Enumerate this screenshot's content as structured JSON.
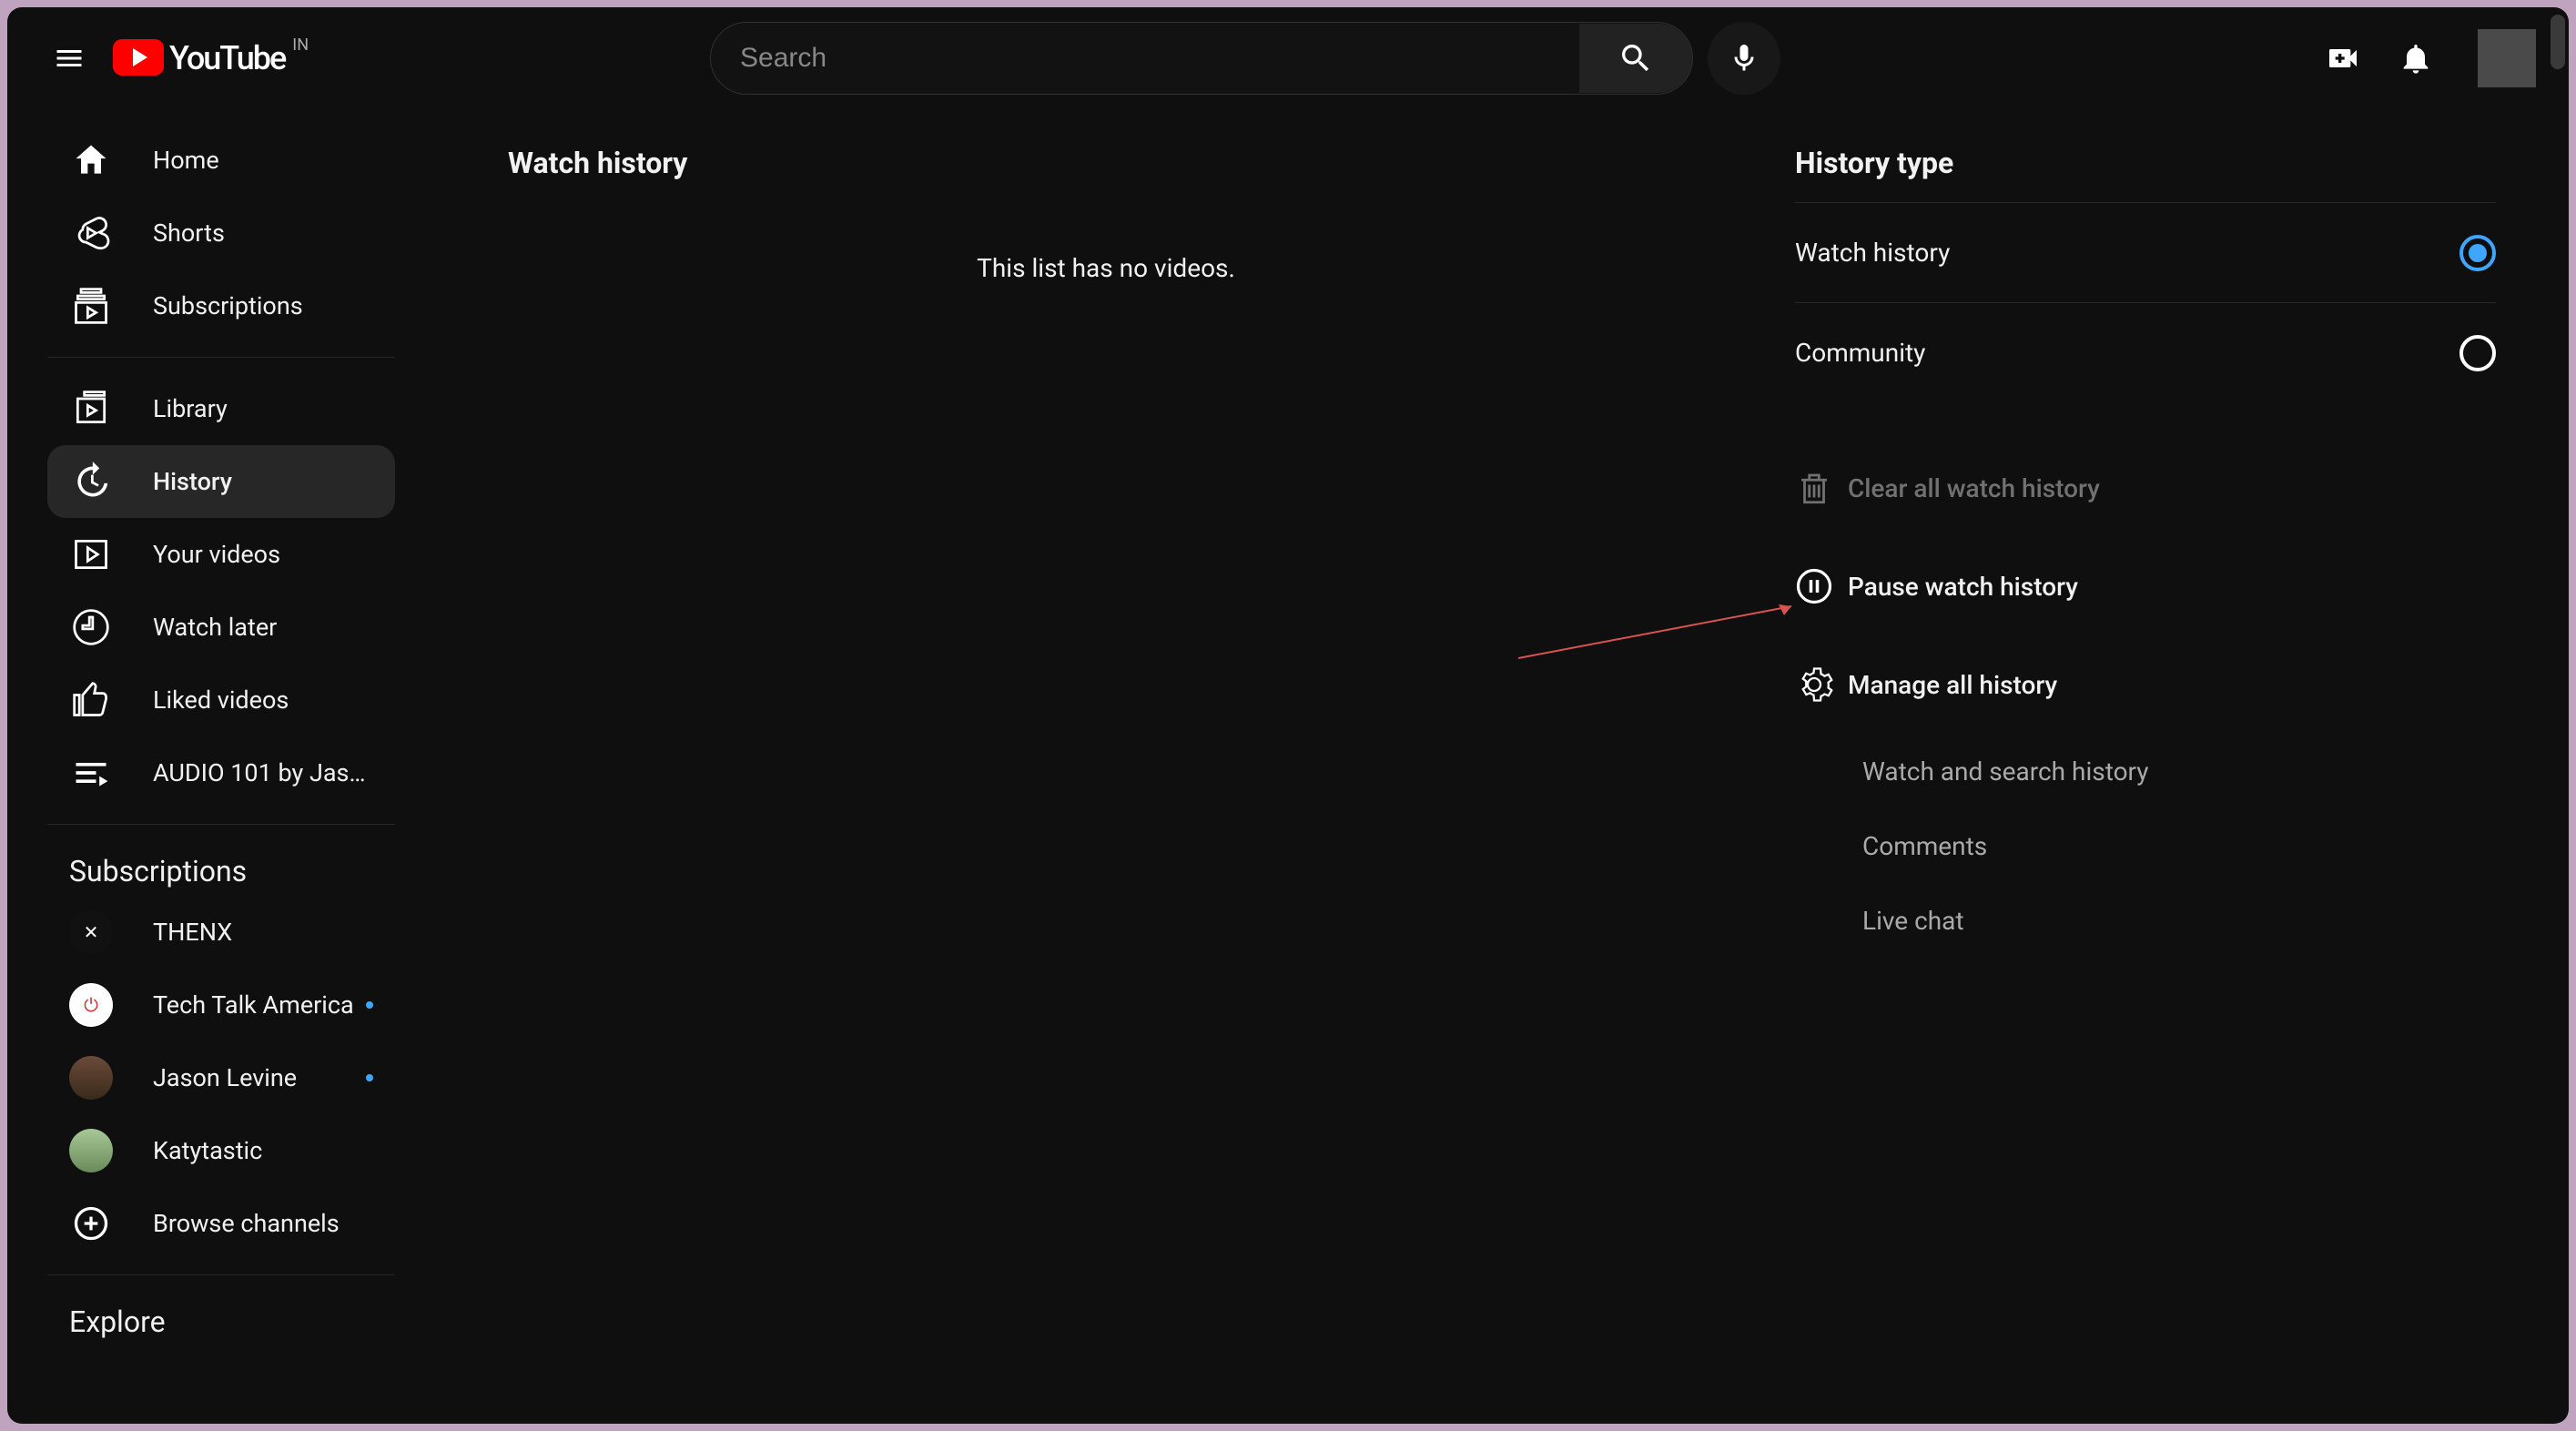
{
  "header": {
    "logo_text": "YouTube",
    "country_code": "IN",
    "search_placeholder": "Search"
  },
  "sidebar": {
    "primary": [
      {
        "label": "Home",
        "icon": "home"
      },
      {
        "label": "Shorts",
        "icon": "shorts"
      },
      {
        "label": "Subscriptions",
        "icon": "subscriptions"
      }
    ],
    "library": [
      {
        "label": "Library",
        "icon": "library"
      },
      {
        "label": "History",
        "icon": "history",
        "active": true
      },
      {
        "label": "Your videos",
        "icon": "yourvideos"
      },
      {
        "label": "Watch later",
        "icon": "watchlater"
      },
      {
        "label": "Liked videos",
        "icon": "liked"
      },
      {
        "label": "AUDIO 101 by Jaso…",
        "icon": "playlist"
      }
    ],
    "subscriptions_title": "Subscriptions",
    "subscriptions": [
      {
        "label": "THENX",
        "avatar_bg": "#111",
        "avatar_text": "✕",
        "new": false
      },
      {
        "label": "Tech Talk America",
        "avatar_bg": "#fff",
        "avatar_text": "⏻",
        "new": true
      },
      {
        "label": "Jason Levine",
        "avatar_bg": "#6b4a3a",
        "avatar_text": "",
        "new": true
      },
      {
        "label": "Katytastic",
        "avatar_bg": "#7a9a6a",
        "avatar_text": "",
        "new": false
      }
    ],
    "browse_channels": "Browse channels",
    "explore_title": "Explore"
  },
  "main": {
    "title": "Watch history",
    "empty": "This list has no videos."
  },
  "panel": {
    "title": "History type",
    "types": [
      {
        "label": "Watch history",
        "selected": true
      },
      {
        "label": "Community",
        "selected": false
      }
    ],
    "actions": {
      "clear": "Clear all watch history",
      "pause": "Pause watch history",
      "manage": "Manage all history"
    },
    "subs": [
      "Watch and search history",
      "Comments",
      "Live chat"
    ]
  }
}
